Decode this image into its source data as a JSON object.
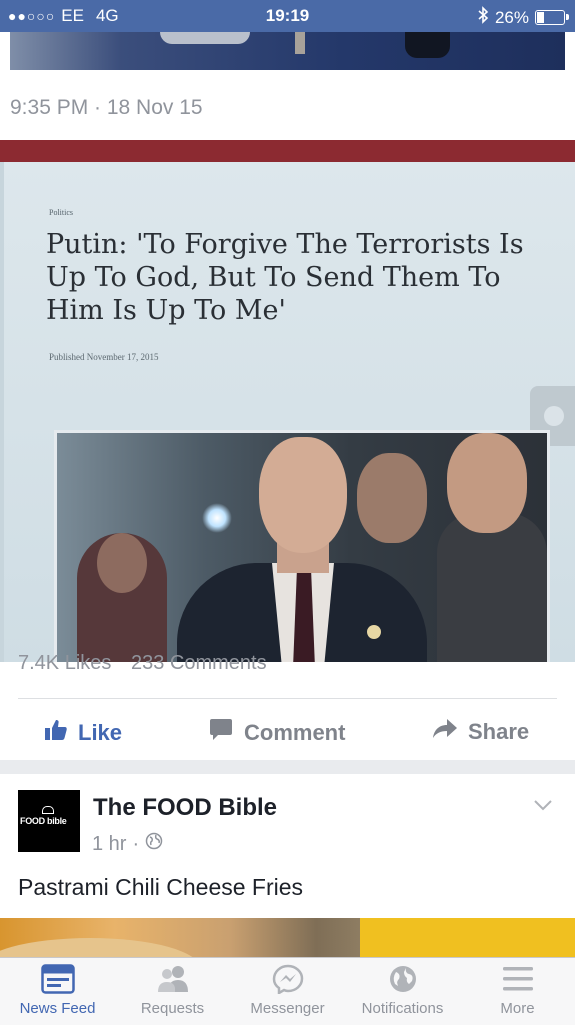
{
  "status_bar": {
    "signal": "●●○○○",
    "carrier": "EE",
    "network": "4G",
    "time": "19:19",
    "battery_text": "26%",
    "battery_level": 0.26
  },
  "post1": {
    "timestamp": "9:35 PM · 18 Nov 15",
    "photo": {
      "section_label": "Politics",
      "headline": "Putin: 'To Forgive The Terrorists Is Up To God, But To Send Them To Him Is Up To Me'",
      "published": "Published November 17, 2015"
    },
    "likes": "7.4K Likes",
    "comments": "233 Comments",
    "actions": {
      "like": "Like",
      "comment": "Comment",
      "share": "Share"
    }
  },
  "post2": {
    "page_name": "The FOOD Bible",
    "logo_text": "FOOD bible",
    "time": "1 hr",
    "separator": "·",
    "text": "Pastrami Chili Cheese Fries"
  },
  "tabbar": {
    "tabs": [
      {
        "label": "News Feed",
        "icon": "news-feed-icon",
        "active": true
      },
      {
        "label": "Requests",
        "icon": "friend-requests-icon",
        "active": false
      },
      {
        "label": "Messenger",
        "icon": "messenger-icon",
        "active": false
      },
      {
        "label": "Notifications",
        "icon": "globe-icon",
        "active": false
      },
      {
        "label": "More",
        "icon": "menu-icon",
        "active": false
      }
    ]
  },
  "colors": {
    "status_bar": "#4a6aa7",
    "facebook_blue": "#4267b2",
    "grey_text": "#90949c"
  }
}
